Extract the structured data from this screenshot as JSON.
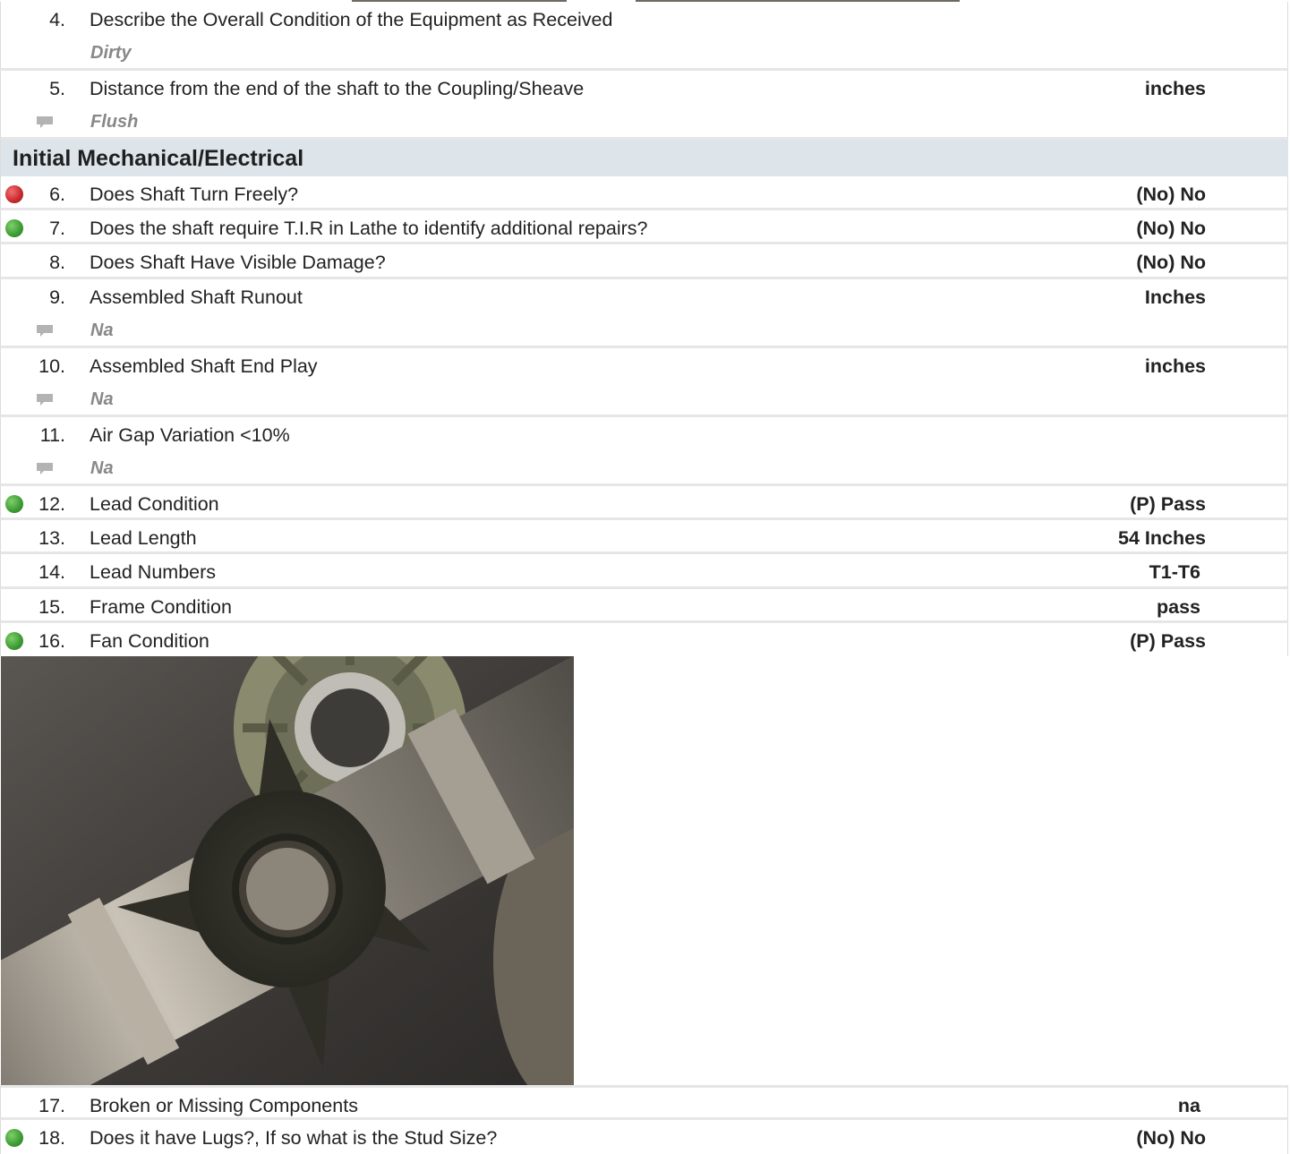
{
  "items": [
    {
      "num": "4.",
      "text": "Describe the Overall Condition of the Equipment as Received",
      "value": "",
      "note": "Dirty"
    },
    {
      "num": "5.",
      "text": "Distance from the end of the shaft to the Coupling/Sheave",
      "value": "inches",
      "note": "Flush"
    },
    {
      "num": "6.",
      "text": "Does Shaft Turn Freely?",
      "value": "(No) No",
      "status": "red"
    },
    {
      "num": "7.",
      "text": "Does the shaft require T.I.R in Lathe to identify additional repairs?",
      "value": "(No) No",
      "status": "green"
    },
    {
      "num": "8.",
      "text": "Does Shaft Have Visible Damage?",
      "value": "(No) No"
    },
    {
      "num": "9.",
      "text": "Assembled Shaft Runout",
      "value": "Inches",
      "note": "Na"
    },
    {
      "num": "10.",
      "text": "Assembled Shaft End Play",
      "value": "inches",
      "note": "Na"
    },
    {
      "num": "11.",
      "text": "Air Gap Variation <10%",
      "value": "",
      "note": "Na"
    },
    {
      "num": "12.",
      "text": "Lead Condition",
      "value": "(P) Pass",
      "status": "green"
    },
    {
      "num": "13.",
      "text": "Lead Length",
      "value": "54 Inches"
    },
    {
      "num": "14.",
      "text": "Lead Numbers",
      "value": "T1-T6"
    },
    {
      "num": "15.",
      "text": "Frame Condition",
      "value": "pass"
    },
    {
      "num": "16.",
      "text": "Fan Condition",
      "value": "(P) Pass",
      "status": "green"
    },
    {
      "num": "17.",
      "text": "Broken or Missing Components",
      "value": "na"
    },
    {
      "num": "18.",
      "text": "Does it have Lugs?, If so what is the Stud Size?",
      "value": "(No) No",
      "status": "green"
    }
  ],
  "section": {
    "title": "Initial Mechanical/Electrical"
  },
  "colors": {
    "status_green": "#3c9a33",
    "status_red": "#c7282c",
    "section_bg": "#dde4ea",
    "note_text": "#888888"
  },
  "icons": {
    "comment": "comment-icon",
    "status": "status-dot-icon"
  }
}
